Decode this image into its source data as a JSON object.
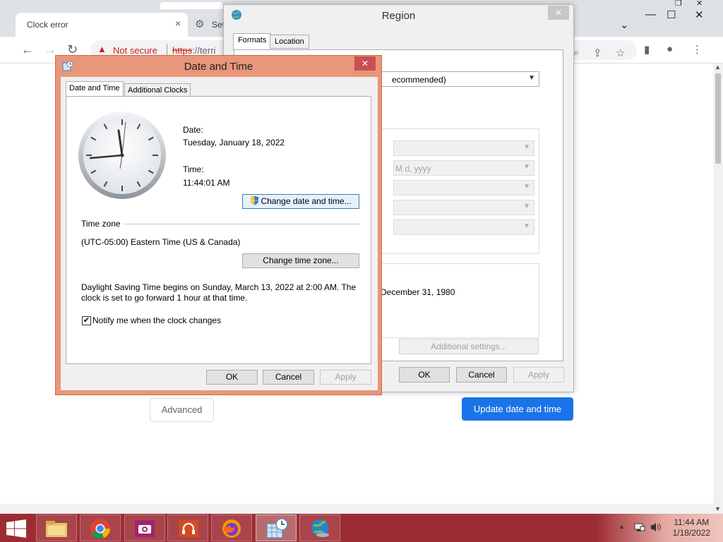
{
  "browser": {
    "tab_title": "Clock error",
    "tab_close": "×",
    "tab2_title": "Set",
    "not_secure": "Not secure",
    "url_prefix": "https",
    "url_rest": "://terri",
    "advanced_label": "Advanced",
    "update_label": "Update date and time"
  },
  "region": {
    "title": "Region",
    "close": "✕",
    "tabs": [
      "Formats",
      "Location"
    ],
    "format_select": "ecommended)",
    "long_date_partial": "M d, yyyy",
    "example_partial": "December 31, 1980",
    "additional_settings": "Additional settings...",
    "ok": "OK",
    "cancel": "Cancel",
    "apply": "Apply"
  },
  "datetime": {
    "title": "Date and Time",
    "close": "✕",
    "tabs": [
      "Date and Time",
      "Additional Clocks"
    ],
    "date_label": "Date:",
    "date_value": "Tuesday, January 18, 2022",
    "time_label": "Time:",
    "time_value": "11:44:01 AM",
    "change_datetime": "Change date and time...",
    "timezone_heading": "Time zone",
    "timezone_value": "(UTC-05:00) Eastern Time (US & Canada)",
    "change_timezone": "Change time zone...",
    "dst_line1": "Daylight Saving Time begins on Sunday, March 13, 2022 at 2:00 AM. The",
    "dst_line2": "clock is set to go forward 1 hour at that time.",
    "notify_label": "Notify me when the clock changes",
    "notify_checked": true,
    "ok": "OK",
    "cancel": "Cancel",
    "apply": "Apply"
  },
  "taskbar": {
    "clock_time": "11:44 AM",
    "clock_date": "1/18/2022",
    "apps": [
      "file-explorer",
      "chrome",
      "camera",
      "music",
      "firefox",
      "date-time-settings",
      "region-settings"
    ]
  }
}
